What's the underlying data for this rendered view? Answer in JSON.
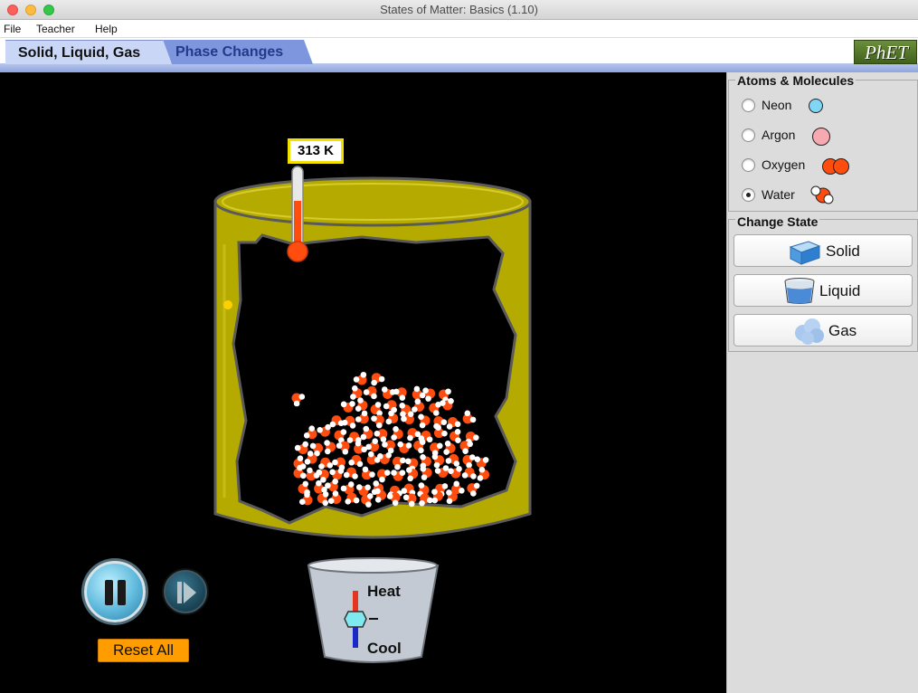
{
  "window": {
    "title": "States of Matter: Basics (1.10)"
  },
  "menu": [
    "File",
    "Teacher",
    "Help"
  ],
  "tabs": [
    "Solid, Liquid, Gas",
    "Phase Changes"
  ],
  "logo": "PhET",
  "simulation": {
    "temperature": "313 K",
    "thermometer_fill_fraction": 0.6,
    "heater": {
      "heat_label": "Heat",
      "cool_label": "Cool",
      "level": 0
    },
    "playback": {
      "state": "playing",
      "reset_label": "Reset All"
    }
  },
  "atoms_molecules": {
    "title": "Atoms & Molecules",
    "options": [
      {
        "label": "Neon",
        "selected": false,
        "color": "#7fd6f5"
      },
      {
        "label": "Argon",
        "selected": false,
        "color": "#f7a9b1"
      },
      {
        "label": "Oxygen",
        "selected": false,
        "color": "#ff4d10"
      },
      {
        "label": "Water",
        "selected": true,
        "color": "#ff4d10"
      }
    ]
  },
  "change_state": {
    "title": "Change State",
    "buttons": [
      "Solid",
      "Liquid",
      "Gas"
    ]
  },
  "colors": {
    "container": "#b5aa00",
    "oxygen": "#ff4d10",
    "hydrogen": "#ffffff",
    "reset_button": "#ff9c00",
    "temperature_border": "#f2e000"
  }
}
